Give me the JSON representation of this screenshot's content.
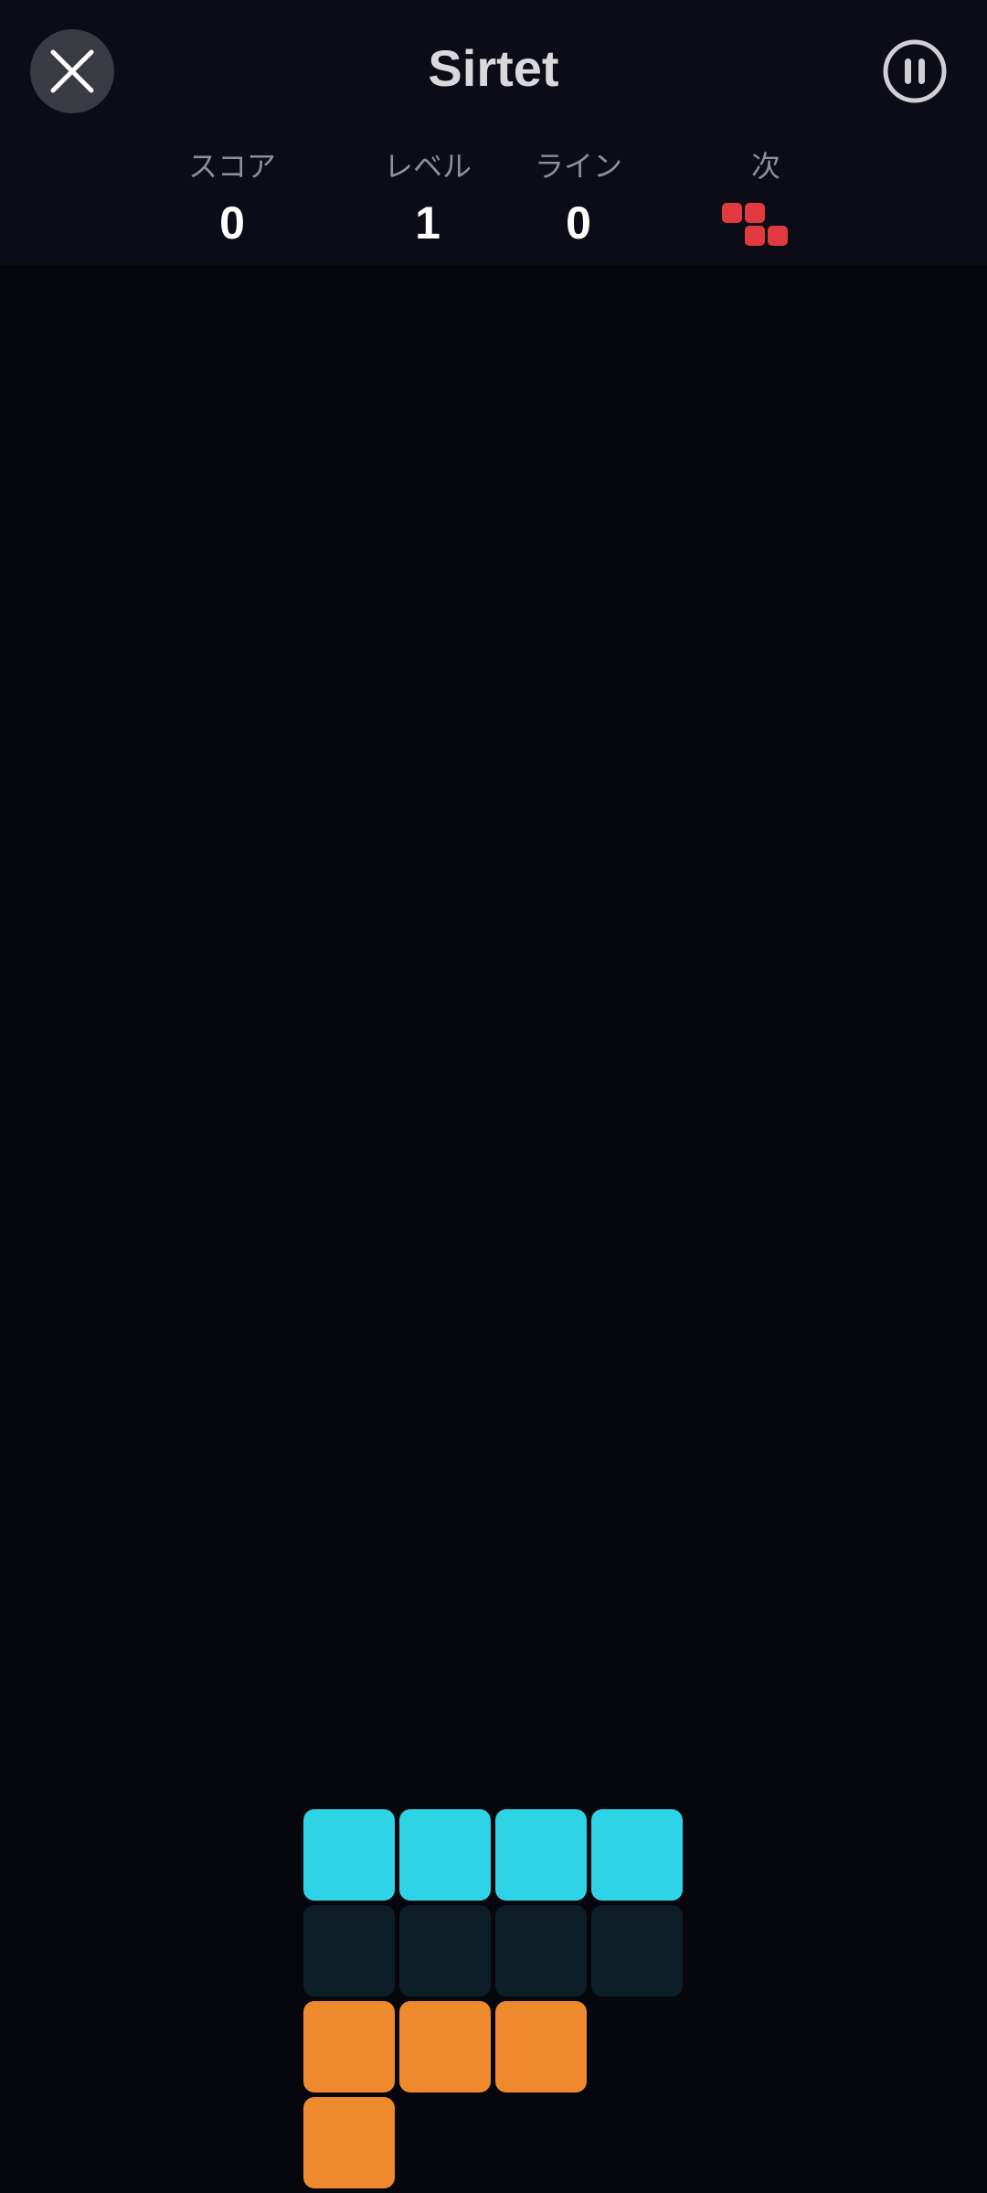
{
  "header": {
    "title": "Sirtet",
    "close_icon": "close-icon",
    "pause_icon": "pause-icon"
  },
  "stats": {
    "score": {
      "label": "スコア",
      "value": "0"
    },
    "level": {
      "label": "レベル",
      "value": "1"
    },
    "lines": {
      "label": "ライン",
      "value": "0"
    },
    "next": {
      "label": "次",
      "piece": "Z",
      "color": "#e0393f"
    }
  },
  "colors": {
    "header_bg": "#0b0c15",
    "board_bg": "#06070c",
    "cyan": "#2ed3e5",
    "ghost": "#0e1e27",
    "orange": "#ee892d",
    "red": "#e0393f"
  },
  "board": {
    "rows": [
      [
        "cyan",
        "cyan",
        "cyan",
        "cyan"
      ],
      [
        "ghost",
        "ghost",
        "ghost",
        "ghost"
      ],
      [
        "orange",
        "orange",
        "orange",
        null
      ],
      [
        "orange",
        null,
        null,
        null
      ]
    ]
  }
}
